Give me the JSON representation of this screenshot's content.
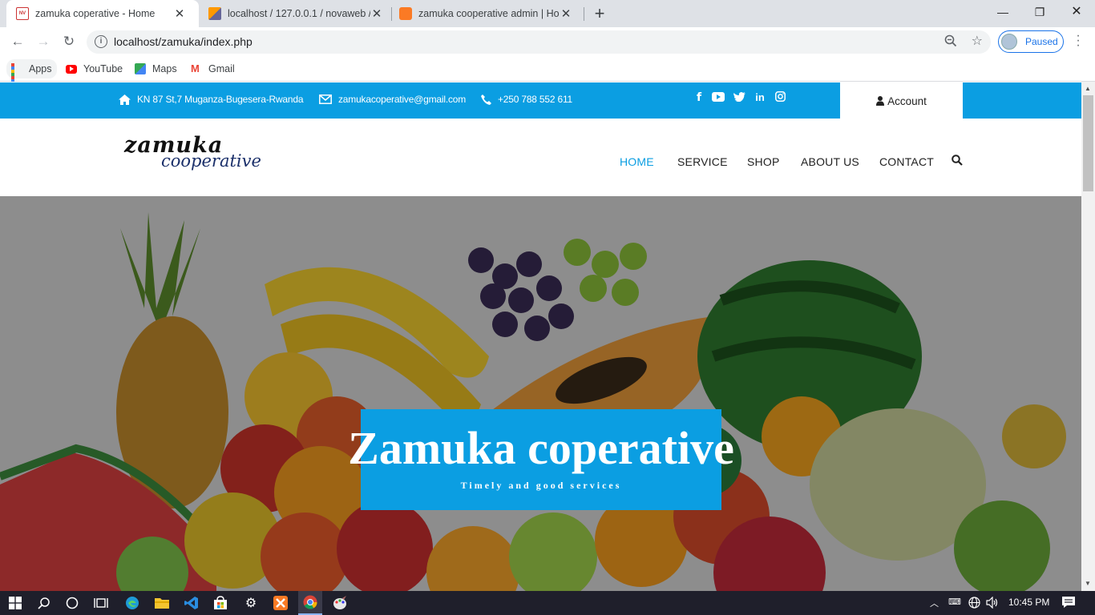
{
  "browser": {
    "tabs": [
      {
        "title": "zamuka coperative - Home",
        "active": true
      },
      {
        "title": "localhost / 127.0.0.1 / novaweb /",
        "active": false
      },
      {
        "title": "zamuka cooperative admin | Hom",
        "active": false
      }
    ],
    "url": "localhost/zamuka/index.php",
    "profile_status": "Paused",
    "bookmarks": [
      "Apps",
      "YouTube",
      "Maps",
      "Gmail"
    ]
  },
  "site": {
    "topbar": {
      "address": "KN 87 St,7 Muganza-Bugesera-Rwanda",
      "email": "zamukacoperative@gmail.com",
      "phone": "+250 788 552 611",
      "social_icons": [
        "facebook-icon",
        "youtube-icon",
        "twitter-icon",
        "linkedin-icon",
        "instagram-icon"
      ],
      "account_label": "Account"
    },
    "logo": {
      "line1": "zamuka",
      "line2": "cooperative"
    },
    "nav": [
      {
        "label": "HOME",
        "active": true
      },
      {
        "label": "SERVICE",
        "active": false
      },
      {
        "label": "SHOP",
        "active": false
      },
      {
        "label": "ABOUT US",
        "active": false
      },
      {
        "label": "CONTACT",
        "active": false
      }
    ],
    "hero": {
      "title": "Zamuka coperative",
      "subtitle": "Timely and good services"
    },
    "colors": {
      "accent": "#0b9ee2"
    }
  },
  "taskbar": {
    "time": "10:45 PM"
  }
}
